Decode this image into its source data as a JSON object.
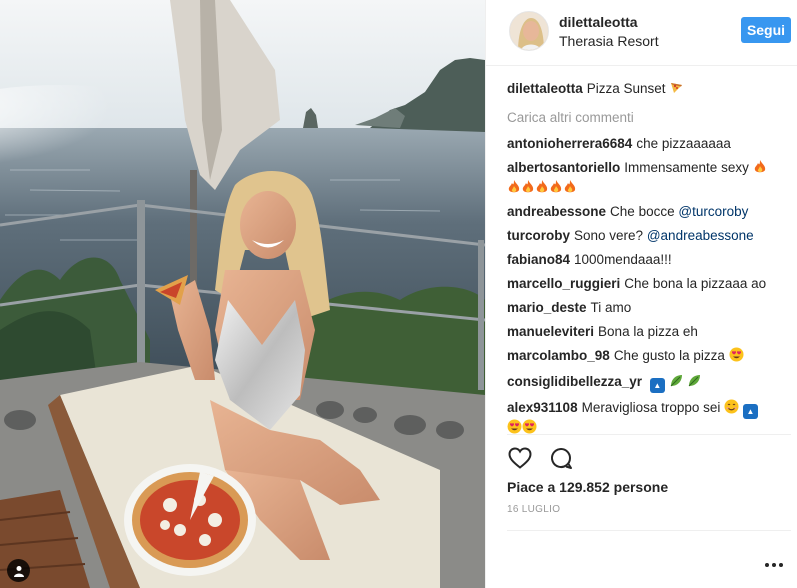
{
  "post": {
    "username": "dilettaleotta",
    "location": "Therasia Resort",
    "follow_label": "Segui",
    "caption_user": "dilettaleotta",
    "caption_text": "Pizza Sunset",
    "load_more": "Carica altri commenti",
    "likes": "Piace a 129.852 persone",
    "date": "16 LUGLIO"
  },
  "comments": [
    {
      "user": "antonioherrera6684",
      "text": "che pizzaaaaaa"
    },
    {
      "user": "albertosantoriello",
      "text": "Immensamente sexy"
    },
    {
      "user": "andreabessone",
      "text": "Che bocce",
      "mention": "@turcoroby"
    },
    {
      "user": "turcoroby",
      "text": "Sono vere?",
      "mention": "@andreabessone"
    },
    {
      "user": "fabiano84",
      "text": "1000mendaaa!!!"
    },
    {
      "user": "marcello_ruggieri",
      "text": "Che bona la pizzaaa ao"
    },
    {
      "user": "mario_deste",
      "text": "Ti amo"
    },
    {
      "user": "manueleviteri",
      "text": "Bona la pizza eh"
    },
    {
      "user": "marcolambo_98",
      "text": "Che gusto la pizza"
    },
    {
      "user": "consiglidibellezza_yr",
      "text": ""
    },
    {
      "user": "alex931108",
      "text": "Meravigliosa troppo sei"
    }
  ],
  "icons": {
    "heart": "heart-icon",
    "comment": "comment-icon",
    "tag": "person-tag-icon",
    "more": "more-options-icon"
  },
  "colors": {
    "follow_button": "#3897f0",
    "mention": "#003569",
    "muted": "#999999"
  }
}
